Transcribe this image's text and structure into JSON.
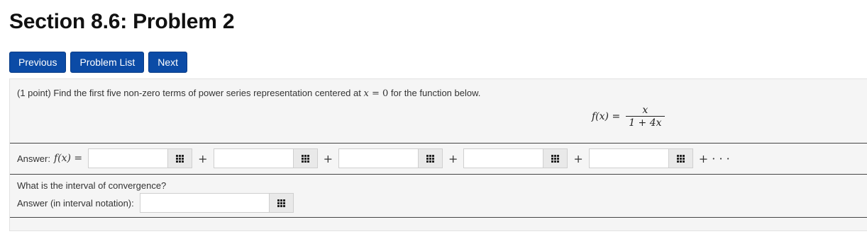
{
  "page": {
    "title": "Section 8.6: Problem 2"
  },
  "nav": {
    "previous": "Previous",
    "problem_list": "Problem List",
    "next": "Next"
  },
  "problem": {
    "points": "(1 point)",
    "prompt_before": "Find the first five non-zero terms of power series representation centered at",
    "prompt_math_var": "x",
    "prompt_math_eq": " = 0",
    "prompt_after": "for the function below.",
    "formula": {
      "lhs": "f(x) =",
      "numerator": "x",
      "denominator": "1 + 4x"
    }
  },
  "answer1": {
    "label": "Answer:",
    "math_label": "f(x) =",
    "plus_sign": "+",
    "trailing": "+ · · ·",
    "values": [
      "",
      "",
      "",
      "",
      ""
    ]
  },
  "question2": {
    "text": "What is the interval of convergence?",
    "label": "Answer (in interval notation):",
    "value": ""
  },
  "icons": {
    "equation_editor": "equation-editor-grid-icon"
  },
  "colors": {
    "nav_button": "#0b4ba6",
    "panel_bg": "#f5f5f5"
  }
}
